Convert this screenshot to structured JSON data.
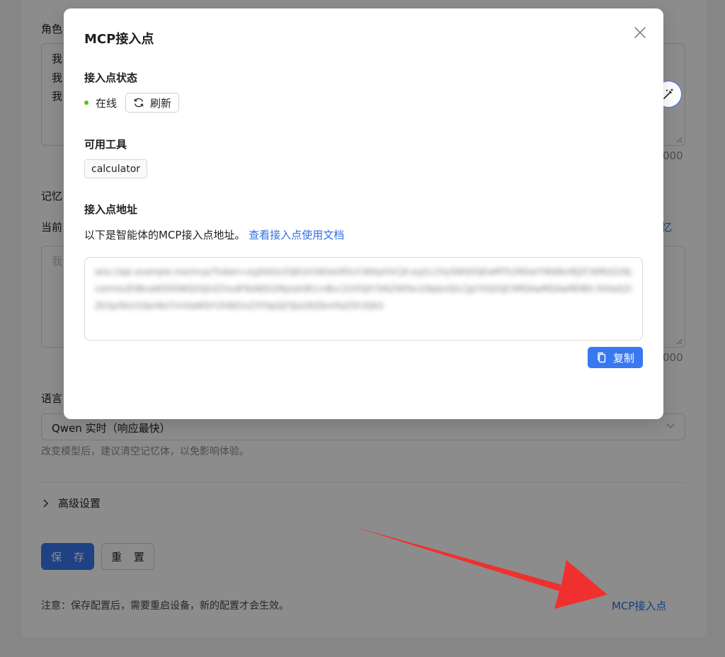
{
  "background": {
    "role_label": "角色",
    "role_lines": [
      "我",
      "我",
      "我"
    ],
    "role_counter": "000",
    "memory_label": "记忆",
    "memory_current_label": "当前",
    "memory_link": "忆",
    "memory_placeholder": "我",
    "memory_counter": "000",
    "language_label": "语言",
    "model_select_value": "Qwen 实时（响应最快）",
    "model_hint": "改变模型后，建议清空记忆体，以免影响体验。",
    "advanced_settings": "高级设置",
    "save_button": "保 存",
    "reset_button": "重 置",
    "note": "注意：保存配置后，需要重启设备，新的配置才会生效。",
    "mcp_link": "MCP接入点"
  },
  "modal": {
    "title": "MCP接入点",
    "status_section": "接入点状态",
    "status_value": "在线",
    "refresh_button": "刷新",
    "tools_section": "可用工具",
    "tools": [
      "calculator"
    ],
    "address_section": "接入点地址",
    "address_description": "以下是智能体的MCP接入点地址。",
    "docs_link": "查看接入点使用文档",
    "copy_button": "复制"
  },
  "colors": {
    "accent": "#3a78f2",
    "link": "#2f6fe0",
    "online": "#52c41a",
    "arrow": "#f0302f"
  }
}
